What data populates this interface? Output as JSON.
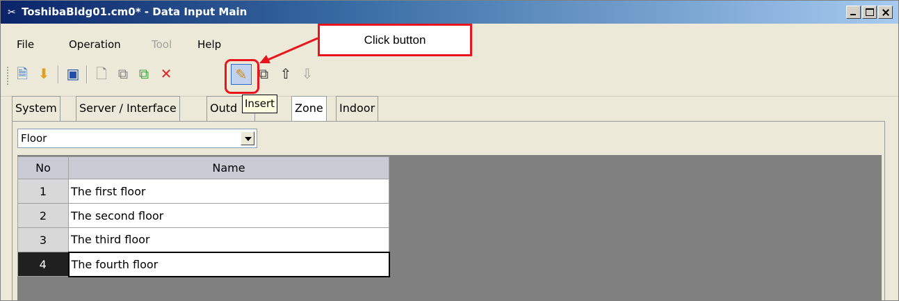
{
  "window": {
    "title": "ToshibaBldg01.cm0* - Data Input Main",
    "title_icon": "tools-icon"
  },
  "menu": [
    {
      "label": "File",
      "enabled": true
    },
    {
      "label": "Operation",
      "enabled": true
    },
    {
      "label": "Tool",
      "enabled": false
    },
    {
      "label": "Help",
      "enabled": true
    }
  ],
  "toolbar": {
    "buttons": [
      "open-icon",
      "import-icon",
      "save-icon",
      "new-icon",
      "copy-icon",
      "paste-icon",
      "delete-icon",
      "insert-icon",
      "properties-icon",
      "move-up-icon",
      "move-down-icon"
    ],
    "insert_tooltip": "Insert"
  },
  "tabs": [
    {
      "label": "System"
    },
    {
      "label": "Server / Interface"
    },
    {
      "label": "Outd"
    },
    {
      "label": "Zone"
    },
    {
      "label": "Indoor"
    }
  ],
  "combo": {
    "value": "Floor"
  },
  "grid": {
    "columns": [
      "No",
      "Name"
    ],
    "rows": [
      {
        "no": "1",
        "name": "The first floor"
      },
      {
        "no": "2",
        "name": "The second floor"
      },
      {
        "no": "3",
        "name": "The third floor"
      },
      {
        "no": "4",
        "name": "The fourth floor"
      }
    ],
    "selected_row": 4
  },
  "annotation": {
    "text": "Click button",
    "color": "#e8141c"
  }
}
